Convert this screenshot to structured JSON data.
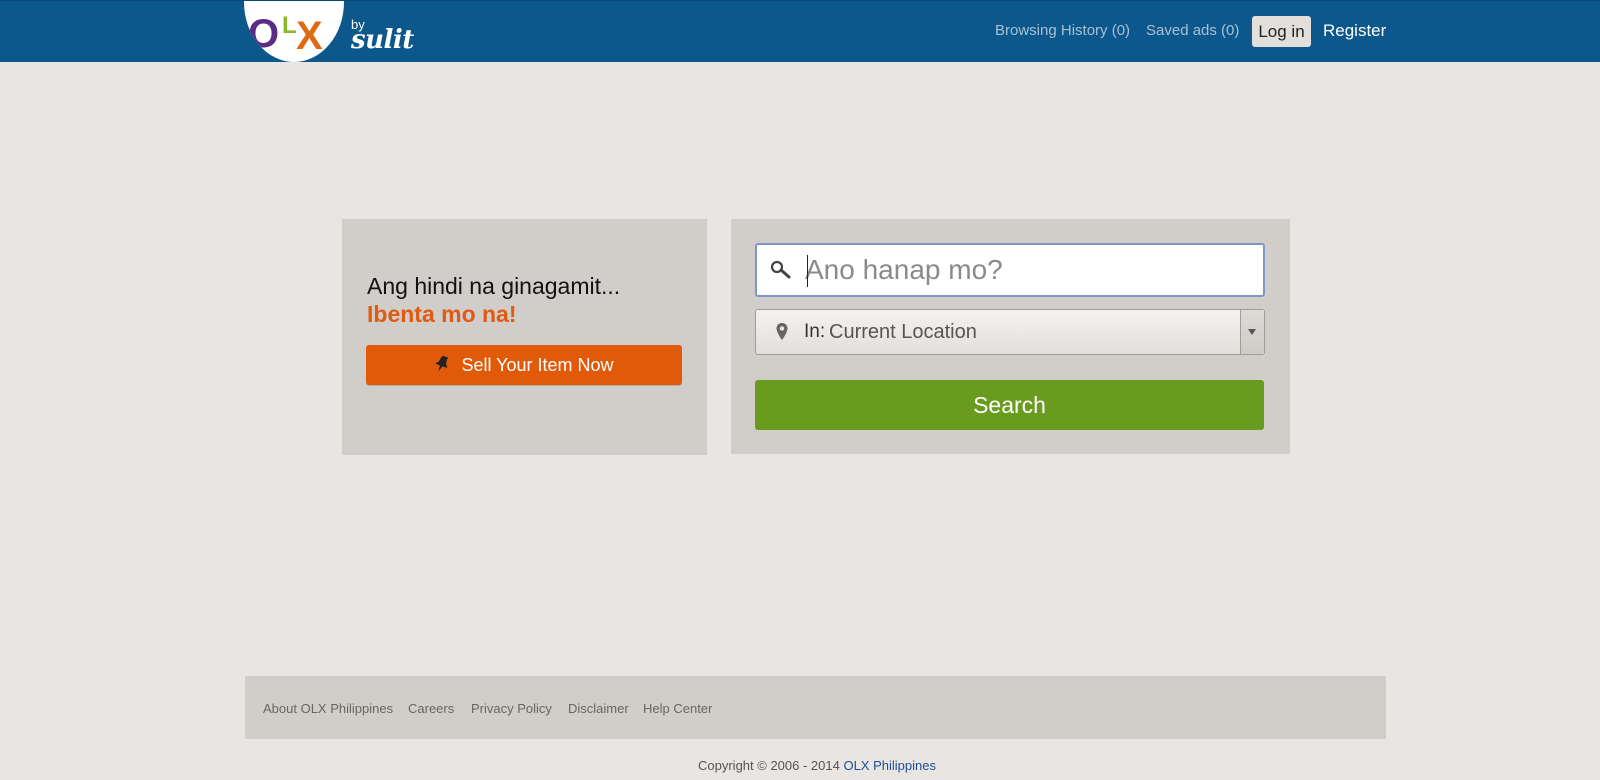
{
  "header": {
    "logo": {
      "letters": [
        "O",
        "L",
        "X"
      ],
      "by": "by",
      "brand": "sulit",
      "colors": [
        "#5b2d82",
        "#8ab82c",
        "#e06a14"
      ]
    },
    "nav": {
      "browsing_history": "Browsing History (0)",
      "saved_ads": "Saved ads (0)",
      "login": "Log in",
      "register": "Register"
    }
  },
  "sell_panel": {
    "tagline": "Ang hindi na ginagamit...",
    "tagline_accent": "Ibenta mo na!",
    "sell_button": "Sell Your Item Now",
    "sell_icon": "pushpin-icon"
  },
  "search_panel": {
    "search": {
      "placeholder": "Ano hanap mo?",
      "value": "",
      "icon": "search-icon"
    },
    "location": {
      "prefix": "In:",
      "value": "Current Location",
      "icon": "map-pin-icon"
    },
    "search_button": "Search"
  },
  "footer": {
    "links": [
      "About OLX Philippines",
      "Careers",
      "Privacy Policy",
      "Disclaimer",
      "Help Center"
    ],
    "copyright": "Copyright © 2006 - 2014",
    "copyright_link": "OLX Philippines"
  },
  "colors": {
    "header_bg": "#0c578c",
    "page_bg": "#e8e5e2",
    "panel_bg": "#d1cdc8",
    "accent_orange": "#e05a0a",
    "search_green": "#699b1e",
    "link_blue": "#1f4f95"
  }
}
